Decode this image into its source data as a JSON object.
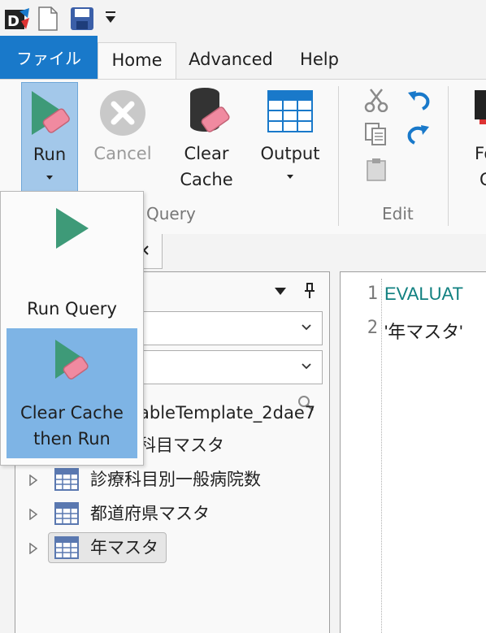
{
  "qat": {
    "icons": [
      "app-logo-icon",
      "new-file-icon",
      "save-icon",
      "customize-qat-icon"
    ]
  },
  "tabs": {
    "file": "ファイル",
    "home": "Home",
    "advanced": "Advanced",
    "help": "Help"
  },
  "ribbon": {
    "run": "Run",
    "cancel": "Cancel",
    "clear_cache_line1": "Clear",
    "clear_cache_line2": "Cache",
    "output": "Output",
    "query_group": "Query",
    "edit_group": "Edit",
    "format_line1": "Fo",
    "format_line2": "C"
  },
  "run_menu": {
    "run_query": "Run Query",
    "clear_cache_then_run_line1": "Clear Cache",
    "clear_cache_then_run_line2": "then Run"
  },
  "left_panel": {
    "tree_items": [
      {
        "label": "ableTemplate_2dae7"
      },
      {
        "label": "科目マスタ"
      },
      {
        "label": "診療科目別一般病院数"
      },
      {
        "label": "都道府県マスタ"
      },
      {
        "label": "年マスタ",
        "selected": true
      }
    ]
  },
  "editor": {
    "lines": [
      {
        "number": "1",
        "text": "EVALUAT",
        "color": "#118080"
      },
      {
        "number": "2",
        "text": "'年マスタ'",
        "color": "#1e1e1e"
      }
    ]
  },
  "colors": {
    "accent": "#1979ca",
    "menu_highlight": "#7eb4e5",
    "run_button_bg": "#a3c8ea"
  }
}
